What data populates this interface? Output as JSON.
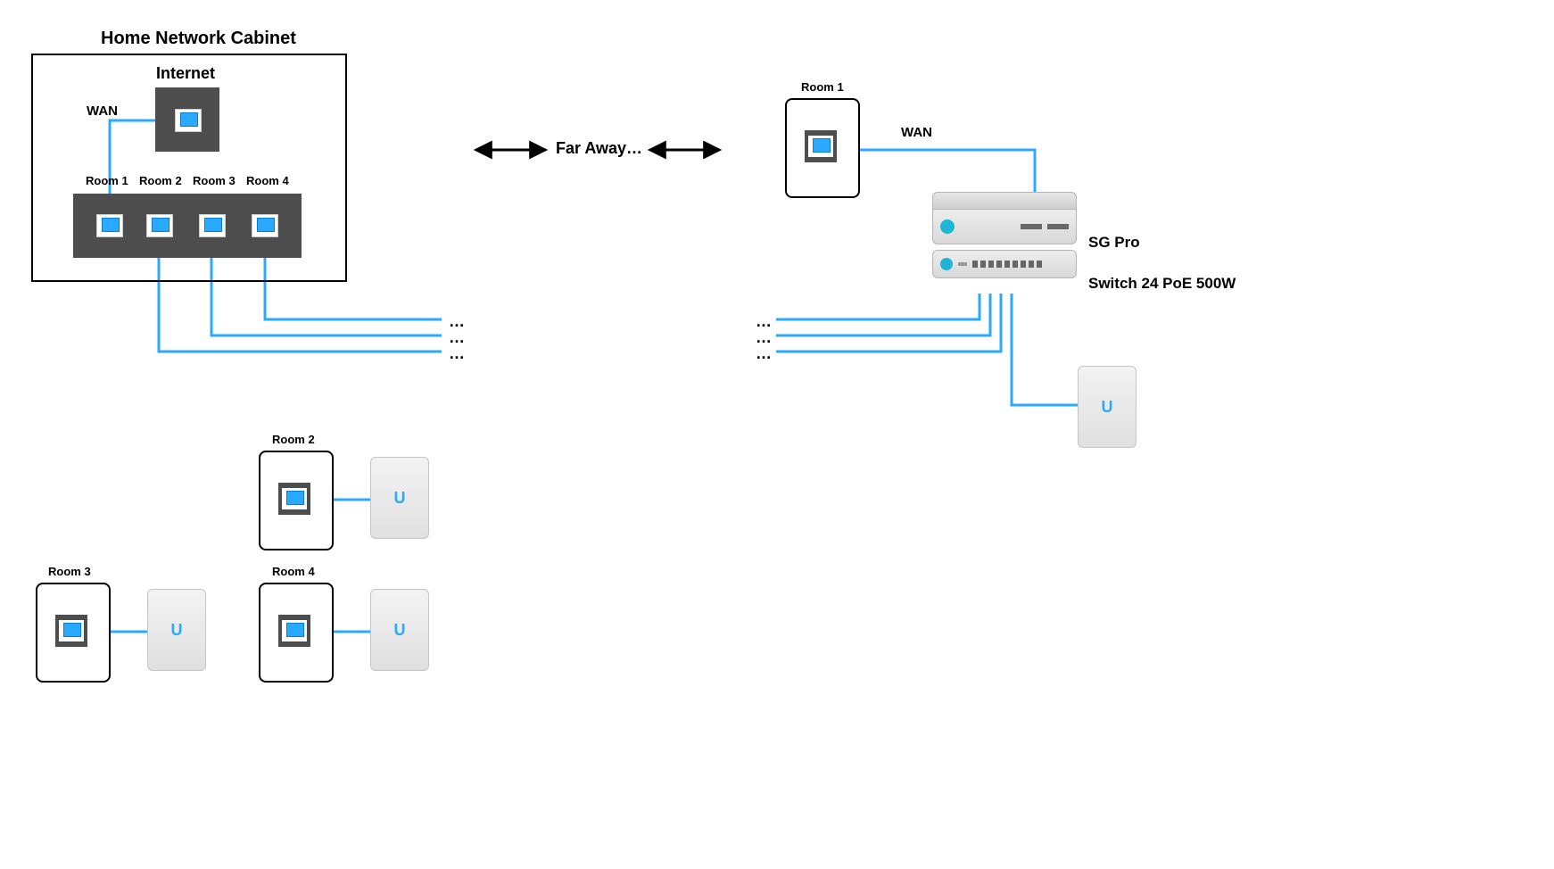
{
  "title": "Home Network Cabinet",
  "internet_label": "Internet",
  "wan_label": "WAN",
  "rooms": {
    "r1": "Room 1",
    "r2": "Room 2",
    "r3": "Room 3",
    "r4": "Room 4"
  },
  "far_away": "Far Away…",
  "ellipsis": "…",
  "devices": {
    "sg": "SG Pro",
    "switch": "Switch 24 PoE 500W"
  },
  "colors": {
    "cable": "#29a9ff",
    "panel": "#4d4d4d"
  }
}
